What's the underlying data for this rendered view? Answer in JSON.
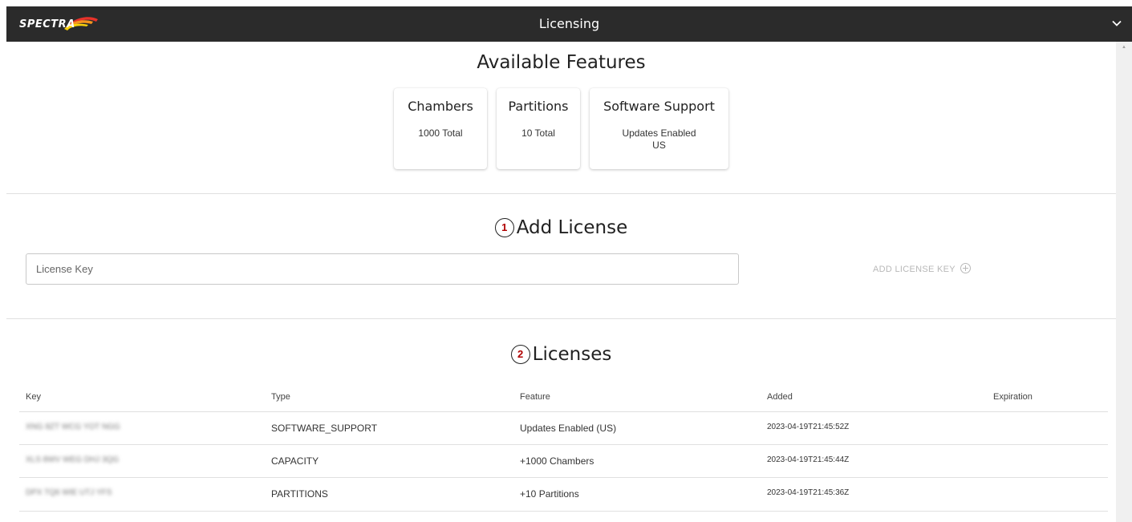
{
  "window": {
    "logo_text": "SPECTRA",
    "title": "Licensing"
  },
  "features": {
    "heading": "Available Features",
    "cards": [
      {
        "title": "Chambers",
        "lines": [
          "1000 Total"
        ]
      },
      {
        "title": "Partitions",
        "lines": [
          "10 Total"
        ]
      },
      {
        "title": "Software Support",
        "lines": [
          "Updates Enabled",
          "US"
        ]
      }
    ]
  },
  "add_license": {
    "step": "1",
    "heading": "Add License",
    "input_placeholder": "License Key",
    "input_value": "",
    "add_button_label": "ADD LICENSE KEY"
  },
  "licenses": {
    "step": "2",
    "heading": "Licenses",
    "columns": [
      "Key",
      "Type",
      "Feature",
      "Added",
      "Expiration"
    ],
    "rows": [
      {
        "key": "XNG 8ZT WCG YOT NGG",
        "type": "SOFTWARE_SUPPORT",
        "feature": "Updates Enabled (US)",
        "added": "2023-04-19T21:45:52Z",
        "expiration": ""
      },
      {
        "key": "XLS 8WV WEG DHJ 3QG",
        "type": "CAPACITY",
        "feature": "+1000 Chambers",
        "added": "2023-04-19T21:45:44Z",
        "expiration": ""
      },
      {
        "key": "DPX TQ6 WIE UTJ YFS",
        "type": "PARTITIONS",
        "feature": "+10 Partitions",
        "added": "2023-04-19T21:45:36Z",
        "expiration": ""
      }
    ]
  },
  "colors": {
    "topbar_bg": "#2b2b2b",
    "badge_number": "#b00000",
    "disabled_text": "#b8b8b8"
  },
  "icons": {
    "chevron": "chevron-down-icon",
    "add": "add-circle-icon"
  }
}
